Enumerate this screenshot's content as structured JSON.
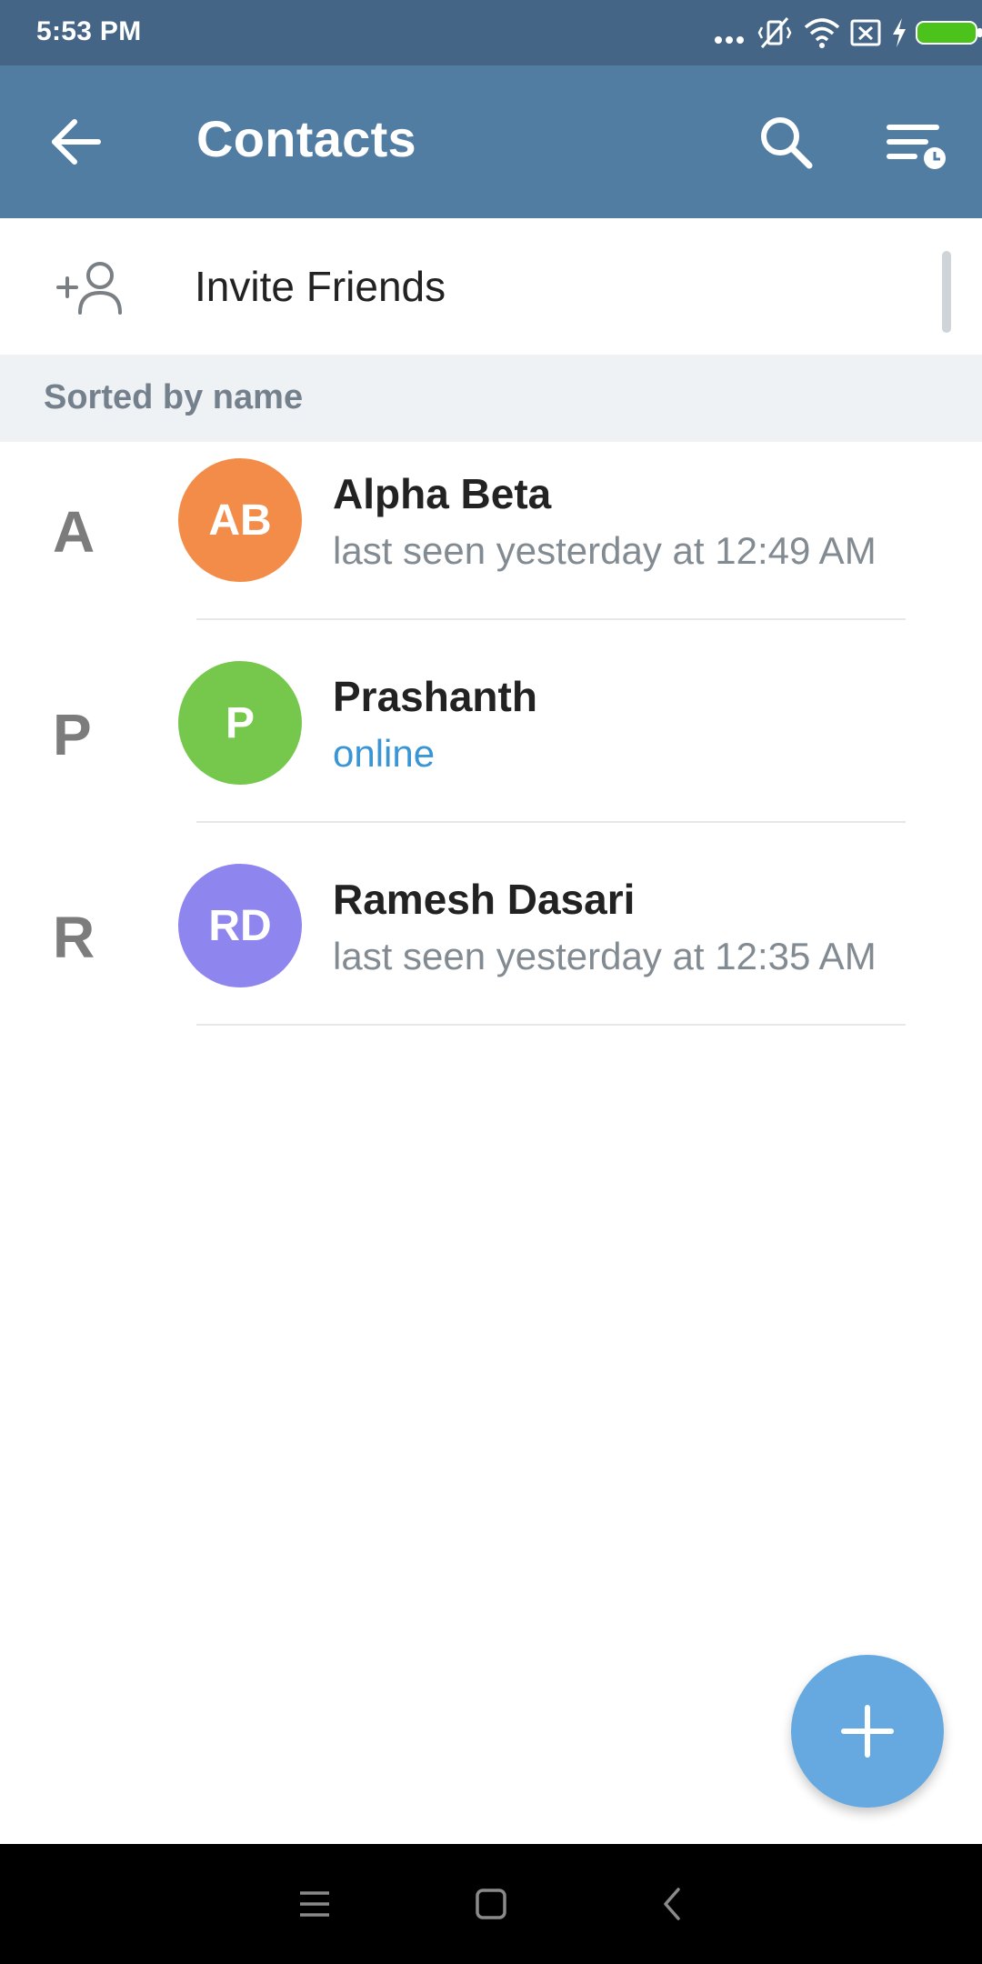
{
  "status_bar": {
    "time": "5:53 PM",
    "icons": [
      "more-dots-icon",
      "vibrate-off-icon",
      "wifi-icon",
      "no-sim-icon",
      "charging-bolt-icon",
      "battery-icon"
    ],
    "battery_color": "#4cc31b"
  },
  "app_bar": {
    "title": "Contacts",
    "back_icon": "arrow-back-icon",
    "search_icon": "search-icon",
    "sort_icon": "sort-by-last-seen-icon",
    "background": "#527da3"
  },
  "invite": {
    "label": "Invite Friends",
    "icon": "add-person-icon"
  },
  "section": {
    "label": "Sorted by name"
  },
  "contacts": [
    {
      "letter": "A",
      "initials": "AB",
      "name": "Alpha Beta",
      "status": "last seen yesterday at 12:49 AM",
      "avatar_color": "#f28c48",
      "online": false
    },
    {
      "letter": "P",
      "initials": "P",
      "name": "Prashanth",
      "status": "online",
      "avatar_color": "#76c84d",
      "online": true
    },
    {
      "letter": "R",
      "initials": "RD",
      "name": "Ramesh Dasari",
      "status": "last seen yesterday at 12:35 AM",
      "avatar_color": "#8e85ee",
      "online": false
    }
  ],
  "fab": {
    "icon": "plus-icon",
    "color": "#65a9e0"
  },
  "nav_bar": {
    "icons": [
      "menu-icon",
      "home-square-icon",
      "back-chevron-icon"
    ]
  }
}
